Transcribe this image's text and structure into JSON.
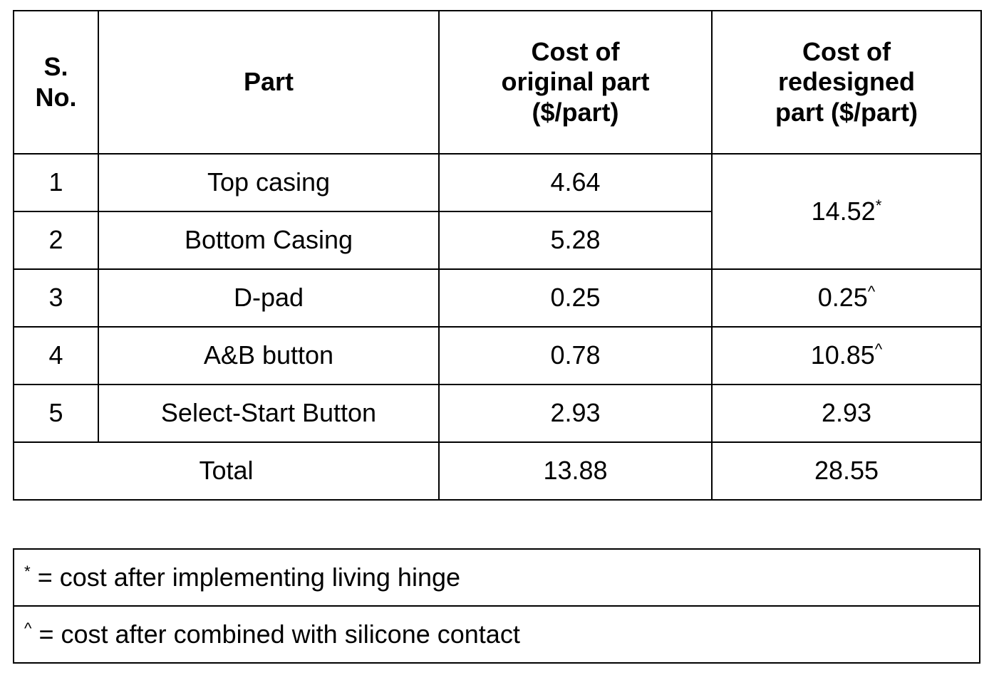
{
  "table": {
    "name": "part-cost-comparison-table",
    "headers": {
      "sno": "S.\nNo.",
      "sno_line1": "S.",
      "sno_line2": "No.",
      "part": "Part",
      "original_cost": "Cost of original part ($/part)",
      "original_cost_line1": "Cost of",
      "original_cost_line2": "original part",
      "original_cost_line3": "($/part)",
      "redesigned_cost": "Cost of redesigned part ($/part)",
      "redesigned_cost_line1": "Cost of",
      "redesigned_cost_line2": "redesigned",
      "redesigned_cost_line3": "part ($/part)"
    },
    "rows": [
      {
        "sno": "1",
        "part": "Top casing",
        "original": "4.64",
        "redesigned": "14.52",
        "redesigned_mark": "*",
        "redesigned_merged": true,
        "merge_span": 2
      },
      {
        "sno": "2",
        "part": "Bottom Casing",
        "original": "5.28",
        "redesigned": "",
        "redesigned_mark": "",
        "redesigned_merged": false,
        "merge_span": 0
      },
      {
        "sno": "3",
        "part": "D-pad",
        "original": "0.25",
        "redesigned": "0.25",
        "redesigned_mark": "^",
        "redesigned_merged": false,
        "merge_span": 1
      },
      {
        "sno": "4",
        "part": "A&B button",
        "original": "0.78",
        "redesigned": "10.85",
        "redesigned_mark": "^",
        "redesigned_merged": false,
        "merge_span": 1
      },
      {
        "sno": "5",
        "part": "Select-Start Button",
        "original": "2.93",
        "redesigned": "2.93",
        "redesigned_mark": "",
        "redesigned_merged": false,
        "merge_span": 1
      }
    ],
    "total": {
      "label": "Total",
      "original": "13.88",
      "redesigned": "28.55"
    }
  },
  "legend": {
    "rows": [
      {
        "mark": "*",
        "text": " = cost after implementing living hinge"
      },
      {
        "mark": "^",
        "text": " = cost after combined with silicone contact"
      }
    ]
  },
  "colors": {
    "border": "#000000",
    "text": "#000000",
    "background": "#ffffff"
  }
}
